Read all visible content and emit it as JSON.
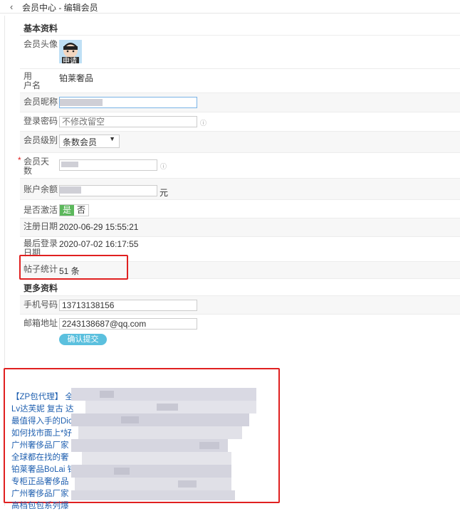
{
  "header": {
    "title": "会员中心 - 编辑会员"
  },
  "sections": {
    "basic": "基本资料",
    "more": "更多资料"
  },
  "fields": {
    "avatar_label": "会员头像",
    "avatar_caption": "申请",
    "username_label": "用　户名",
    "username_value": "铂莱奢品",
    "nickname_label": "会员昵称",
    "password_label": "登录密码",
    "password_value": "不修改留空",
    "level_label": "会员级别",
    "level_value": "条数会员",
    "days_label": "会员天数",
    "required_mark": "*",
    "balance_label": "账户余额",
    "balance_unit": "元",
    "active_label": "是否激活",
    "active_yes": "是",
    "active_no": "否",
    "register_label": "注册日期",
    "register_value": "2020-06-29 15:55:21",
    "lastlogin_label": "最后登录日期",
    "lastlogin_value": "2020-07-02 16:17:55",
    "posts_label": "帖子统计",
    "posts_value": "51 条",
    "phone_label": "手机号码",
    "phone_value": "13713138156",
    "email_label": "邮箱地址",
    "email_value": "2243138687@qq.com",
    "help_icon": "question-icon"
  },
  "actions": {
    "confirm": "确认提交"
  },
  "links": [
    "【ZP包代理】 全",
    "Lv达芙妮 复古 达",
    "最值得入手的Dic",
    "如何找市面上*好",
    "广州奢侈品厂家",
    "全球都在找的奢",
    "铂莱奢品BoLai 铂",
    "专柜正品奢侈品",
    "广州奢侈品厂家",
    "高档包包系列爆"
  ],
  "colors": {
    "highlight": "#e02020",
    "link": "#2060b0",
    "button": "#5bc0de",
    "active": "#5cb85c"
  }
}
